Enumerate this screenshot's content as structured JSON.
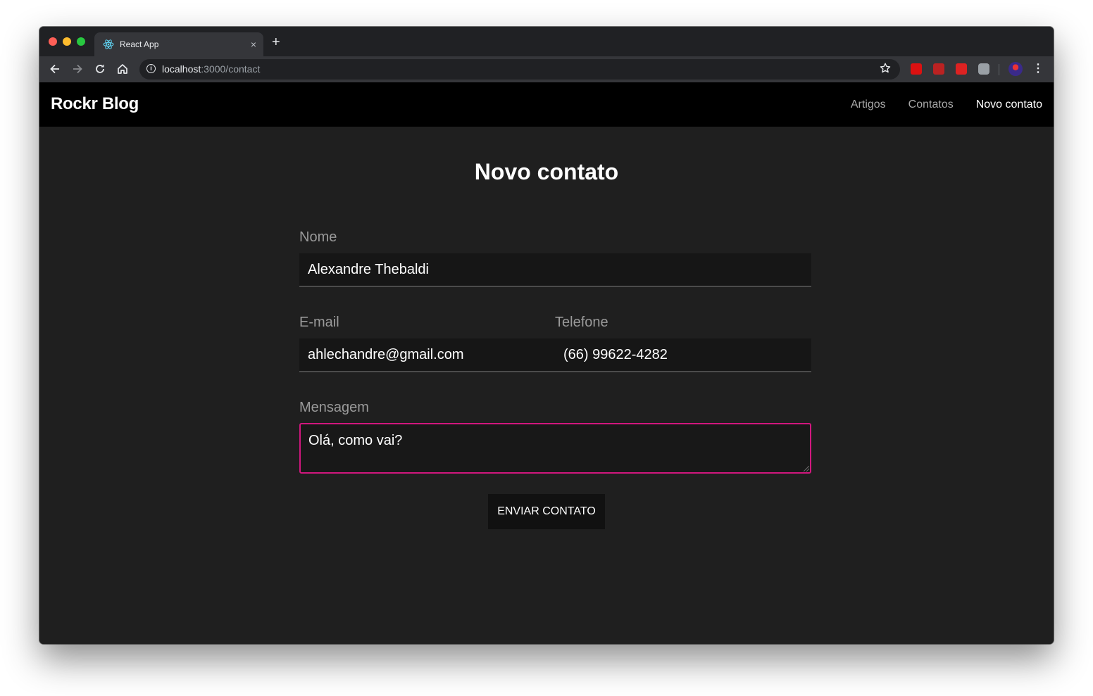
{
  "browser": {
    "tab_title": "React App",
    "tab_close": "×",
    "new_tab": "+",
    "url_host": "localhost",
    "url_path": ":3000/contact"
  },
  "site": {
    "brand": "Rockr Blog",
    "nav": [
      {
        "label": "Artigos",
        "active": false
      },
      {
        "label": "Contatos",
        "active": false
      },
      {
        "label": "Novo contato",
        "active": true
      }
    ]
  },
  "form": {
    "title": "Novo contato",
    "name_label": "Nome",
    "name_value": "Alexandre Thebaldi",
    "email_label": "E-mail",
    "email_value": "ahlechandre@gmail.com",
    "phone_label": "Telefone",
    "phone_value": "(66) 99622-4282",
    "message_label": "Mensagem",
    "message_value": "Olá, como vai?",
    "submit_label": "ENVIAR CONTATO"
  },
  "colors": {
    "navbar_bg": "#000000",
    "page_bg": "#1f1f1f",
    "input_bg": "#161616",
    "focus_border": "#d1177e",
    "label_text": "#9a9a9a"
  },
  "icons": {
    "back": "arrow-left-icon",
    "forward": "arrow-right-icon",
    "reload": "reload-icon",
    "home": "home-icon",
    "info": "info-icon",
    "bookmark": "star-icon",
    "menu": "kebab-menu-icon"
  }
}
